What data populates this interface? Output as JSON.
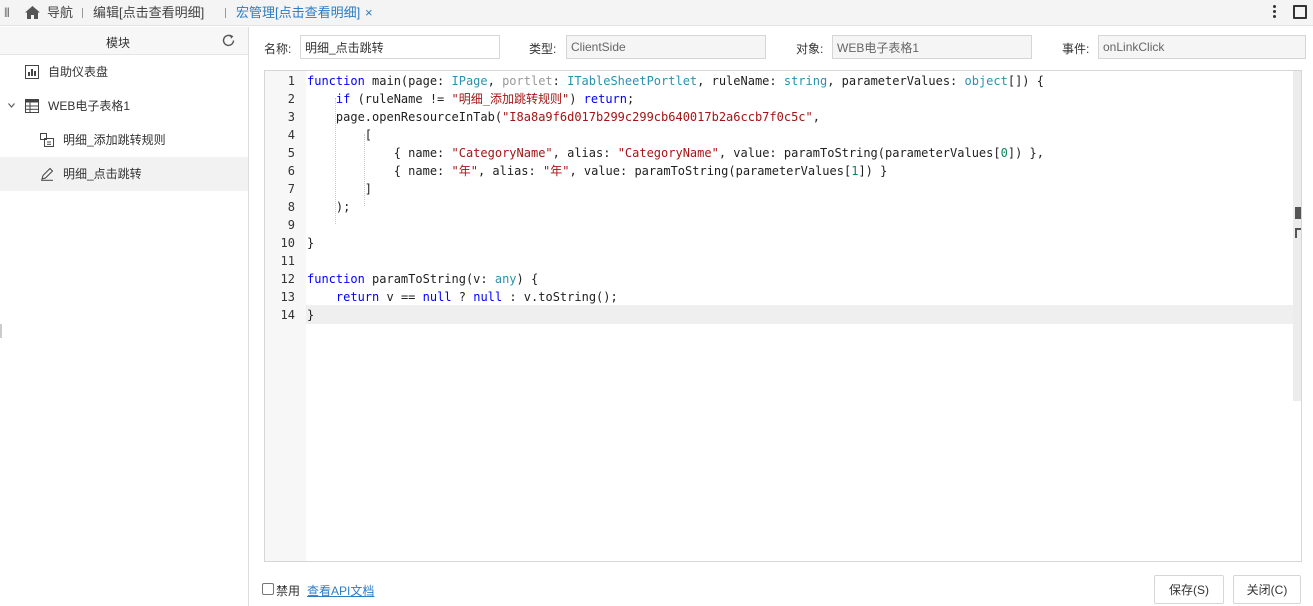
{
  "tabs": {
    "nav": "导航",
    "edit": "编辑[点击查看明细]",
    "macro": "宏管理[点击查看明细]",
    "close_glyph": "×"
  },
  "sidebar": {
    "title": "模块",
    "items": [
      {
        "label": "自助仪表盘",
        "icon": "dashboard-icon"
      },
      {
        "label": "WEB电子表格1",
        "icon": "spreadsheet-icon",
        "expanded": true
      },
      {
        "label": "明细_添加跳转规则",
        "icon": "module-icon"
      },
      {
        "label": "明细_点击跳转",
        "icon": "macro-edit-icon",
        "selected": true
      }
    ]
  },
  "form": {
    "name_label": "名称:",
    "name_value": "明细_点击跳转",
    "type_label": "类型:",
    "type_value": "ClientSide",
    "object_label": "对象:",
    "object_value": "WEB电子表格1",
    "event_label": "事件:",
    "event_value": "onLinkClick"
  },
  "editor": {
    "line_numbers": [
      "1",
      "2",
      "3",
      "4",
      "5",
      "6",
      "7",
      "8",
      "9",
      "10",
      "11",
      "12",
      "13",
      "14"
    ],
    "lines": [
      "function main(page: IPage, portlet: ITableSheetPortlet, ruleName: string, parameterValues: object[]) {",
      "    if (ruleName != \"明细_添加跳转规则\") return;",
      "    page.openResourceInTab(\"I8a8a9f6d017b299c299cb640017b2a6ccb7f0c5c\",",
      "        [",
      "            { name: \"CategoryName\", alias: \"CategoryName\", value: paramToString(parameterValues[0]) },",
      "            { name: \"年\", alias: \"年\", value: paramToString(parameterValues[1]) }",
      "        ]",
      "    );",
      "",
      "}",
      "",
      "function paramToString(v: any) {",
      "    return v == null ? null : v.toString();",
      "}"
    ]
  },
  "footer": {
    "disable_label": "禁用",
    "api_link": "查看API文档",
    "save_button": "保存(S)",
    "close_button": "关闭(C)"
  },
  "colors": {
    "accent": "#2d7cc4",
    "keyword": "#0000ff",
    "type": "#2b91af",
    "string": "#a31515",
    "number": "#098658"
  }
}
